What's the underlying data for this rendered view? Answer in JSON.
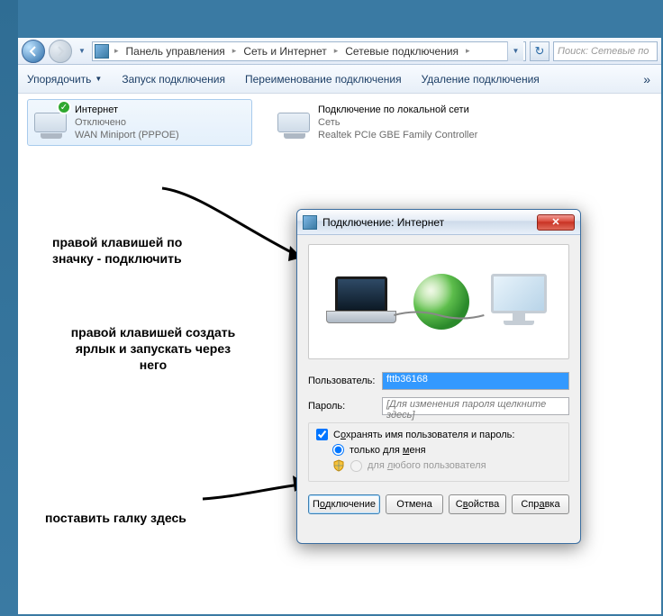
{
  "nav": {
    "crumbs": [
      "Панель управления",
      "Сеть и Интернет",
      "Сетевые подключения"
    ],
    "search_placeholder": "Поиск: Сетевые по"
  },
  "toolbar": {
    "organize": "Упорядочить",
    "start": "Запуск подключения",
    "rename": "Переименование подключения",
    "delete": "Удаление подключения",
    "more": "»"
  },
  "items": [
    {
      "title": "Интернет",
      "status": "Отключено",
      "device": "WAN Miniport (PPPOE)"
    },
    {
      "title": "Подключение по локальной сети",
      "status": "Сеть",
      "device": "Realtek PCIe GBE Family Controller"
    }
  ],
  "annotations": {
    "a1": "правой клавишей по значку - подключить",
    "a2": "правой клавишей создать ярлык и запускать через него",
    "a3": "поставить галку здесь"
  },
  "dialog": {
    "title": "Подключение: Интернет",
    "user_label": "Пользователь:",
    "user_value": "fttb36168",
    "pass_label": "Пароль:",
    "pass_placeholder": "[Для изменения пароля щелкните здесь]",
    "save_label": "Сохранять имя пользователя и пароль:",
    "opt_me": "только для меня",
    "opt_all": "для любого пользователя",
    "btn_connect": "Подключение",
    "btn_cancel": "Отмена",
    "btn_props": "Свойства",
    "btn_help": "Справка"
  }
}
